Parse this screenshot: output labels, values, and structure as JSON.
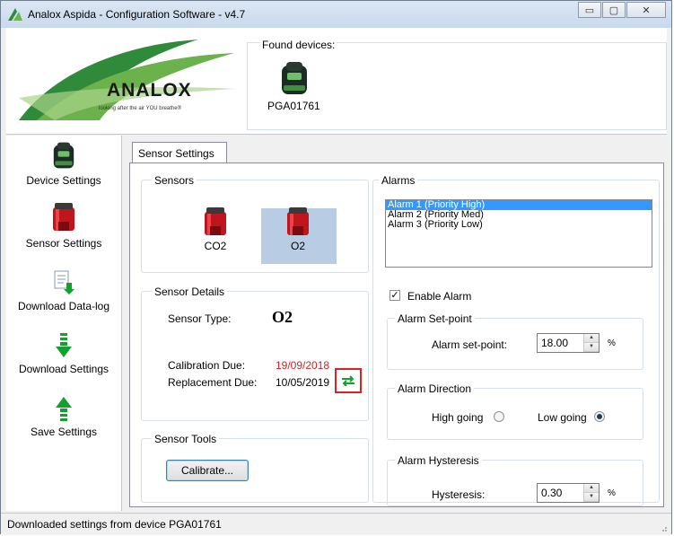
{
  "window": {
    "title": "Analox Aspida - Configuration Software - v4.7",
    "minimize_glyph": "▭",
    "maximize_glyph": "▢",
    "close_glyph": "✕"
  },
  "header": {
    "logo_text": "ANALOX",
    "logo_tagline": "looking after the air YOU breathe®",
    "found_label": "Found devices:",
    "devices": [
      {
        "name": "PGA01761",
        "icon": "device-icon"
      }
    ]
  },
  "sidebar": {
    "items": [
      {
        "label": "Device Settings",
        "icon": "device-icon"
      },
      {
        "label": "Sensor Settings",
        "icon": "sensor-icon"
      },
      {
        "label": "Download Data-log",
        "icon": "download-datalog-icon"
      },
      {
        "label": "Download Settings",
        "icon": "download-arrow-icon"
      },
      {
        "label": "Save Settings",
        "icon": "upload-arrow-icon"
      }
    ]
  },
  "tab": {
    "label": "Sensor Settings"
  },
  "sensors": {
    "title": "Sensors",
    "items": [
      {
        "label": "CO2"
      },
      {
        "label": "O2",
        "selected": true
      }
    ]
  },
  "sensor_details": {
    "title": "Sensor Details",
    "type_label": "Sensor Type:",
    "type_value": "O2",
    "cal_label": "Calibration Due:",
    "cal_value": "19/09/2018",
    "rep_label": "Replacement Due:",
    "rep_value": "10/05/2019",
    "cal_color": "#d62020"
  },
  "sensor_tools": {
    "title": "Sensor Tools",
    "calibrate_label": "Calibrate..."
  },
  "alarms": {
    "title": "Alarms",
    "items": [
      "Alarm 1 (Priority High)",
      "Alarm 2 (Priority Med)",
      "Alarm 3 (Priority Low)"
    ],
    "selected_index": 0,
    "enable_label": "Enable Alarm",
    "enable_checked": true,
    "setpoint_title": "Alarm Set-point",
    "setpoint_label": "Alarm set-point:",
    "setpoint_value": "18.00",
    "setpoint_unit": "%",
    "direction_title": "Alarm Direction",
    "high_label": "High going",
    "low_label": "Low going",
    "direction_selected": "low",
    "hysteresis_title": "Alarm Hysteresis",
    "hysteresis_label": "Hysteresis:",
    "hysteresis_value": "0.30",
    "hysteresis_unit": "%"
  },
  "status": {
    "text": "Downloaded settings from device PGA01761"
  },
  "colors": {
    "selection": "#3399ff",
    "highlight_box": "#e02020",
    "arrow_green": "#12a12e"
  }
}
